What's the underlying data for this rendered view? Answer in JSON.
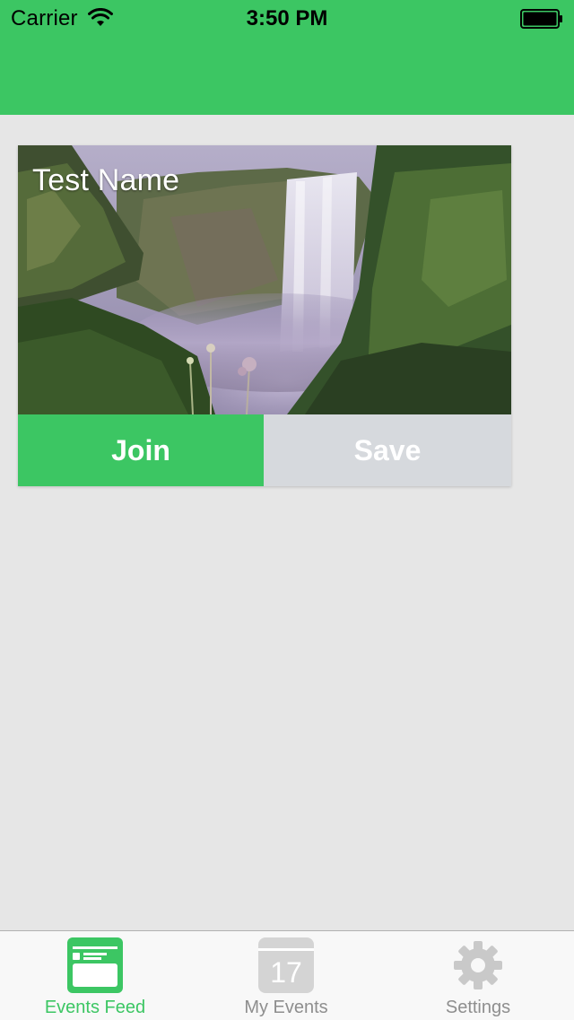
{
  "status_bar": {
    "carrier": "Carrier",
    "time": "3:50 PM",
    "wifi_icon": "wifi-icon",
    "battery_icon": "battery-icon",
    "battery_level": 1.0
  },
  "header": {
    "color": "#3cc663"
  },
  "event_card": {
    "title": "Test Name",
    "image": "waterfall-photo",
    "join_label": "Join",
    "save_label": "Save",
    "join_color": "#3cc663",
    "save_color": "#d6d9dd"
  },
  "tab_bar": {
    "items": [
      {
        "label": "Events Feed",
        "icon": "events-feed-icon",
        "active": true
      },
      {
        "label": "My Events",
        "icon": "calendar-icon",
        "badge_text": "17",
        "active": false
      },
      {
        "label": "Settings",
        "icon": "gear-icon",
        "active": false
      }
    ],
    "active_color": "#3cc663",
    "inactive_color": "#8e8e8e"
  }
}
